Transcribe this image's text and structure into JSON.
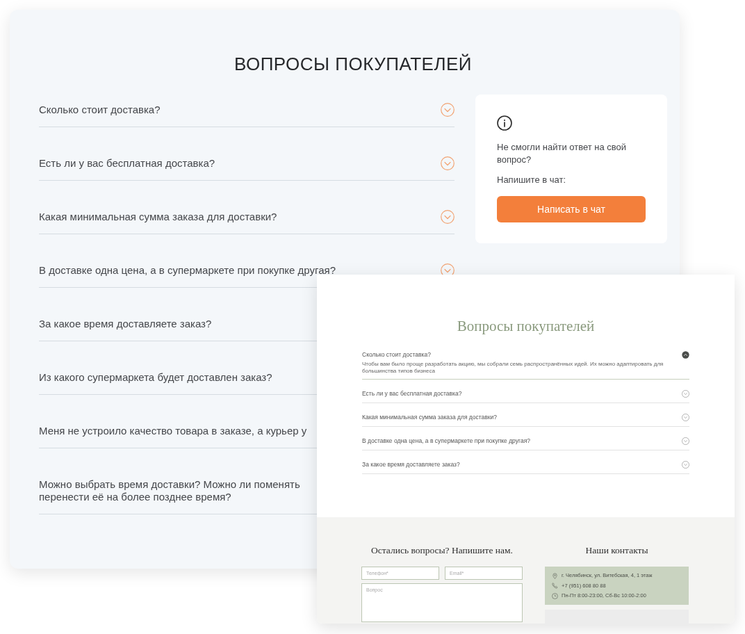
{
  "back_page": {
    "title": "ВОПРОСЫ ПОКУПАТЕЛЕЙ",
    "questions": [
      {
        "kind": "chevron",
        "question": "Сколько стоит доставка?",
        "expanded": false
      },
      {
        "kind": "chevron",
        "question": "Есть ли у вас бесплатная доставка?",
        "expanded": false
      },
      {
        "kind": "chevron",
        "question": "Какая минимальная сумма заказа для доставки?",
        "expanded": false
      },
      {
        "kind": "chevron",
        "question": "В доставке одна цена, а в супермаркете при покупке другая?",
        "expanded": false
      },
      {
        "kind": "plain",
        "question": "За какое время доставляете заказ?"
      },
      {
        "kind": "plain",
        "question": "Из какого супермаркета будет доставлен заказ?"
      },
      {
        "kind": "plain",
        "question": "Меня не устроило качество товара в заказе, а курьер у"
      },
      {
        "kind": "plain",
        "question": "Можно выбрать время доставки? Можно ли поменять\nперенести её на более позднее время?"
      }
    ],
    "help_card": {
      "text": "Не смогли найти ответ на свой вопрос?",
      "prompt": "Напишите в чат:",
      "button": "Написать в чат"
    }
  },
  "front_page": {
    "title": "Вопросы покупателей",
    "questions": [
      {
        "question": "Сколько стоит доставка?",
        "expanded": true,
        "answer": "Чтобы вам было проще разработать акцию, мы собрали семь распространённых идей. Их можно адаптировать для большинства типов бизнеса"
      },
      {
        "question": "Есть ли у вас бесплатная доставка?",
        "expanded": false
      },
      {
        "question": "Какая минимальная сумма заказа для доставки?",
        "expanded": false
      },
      {
        "question": "В доставке одна цена, а в супермаркете при покупке другая?",
        "expanded": false
      },
      {
        "question": "За какое время доставляете заказ?",
        "expanded": false
      }
    ],
    "contact_form": {
      "title": "Остались вопросы? Напишите нам.",
      "fields": [
        {
          "kind": "input",
          "placeholder": "Телефон*"
        },
        {
          "kind": "input",
          "placeholder": "Email*"
        },
        {
          "kind": "textarea",
          "placeholder": "Вопрос"
        }
      ]
    },
    "contacts": {
      "title": "Наши контакты",
      "items": [
        {
          "kind": "address",
          "text": "г. Челябинск, ул. Витебская, 4, 1 этаж"
        },
        {
          "kind": "phone",
          "text": "+7 (951) 608 80 88"
        },
        {
          "kind": "hours",
          "text": "Пн-Пт 8:00-23:00, Сб-Вс 10:00-2:00"
        }
      ]
    }
  }
}
